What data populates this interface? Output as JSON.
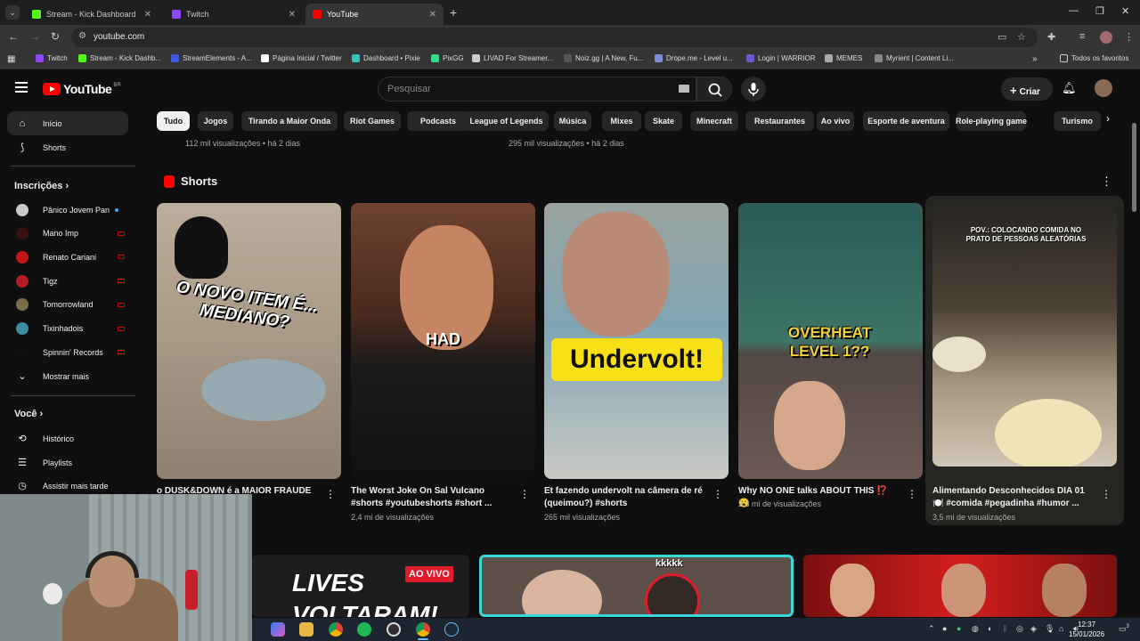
{
  "browser": {
    "tabs": [
      {
        "label": "Stream - Kick Dashboard",
        "color": "#53fc18"
      },
      {
        "label": "Twitch",
        "color": "#9146ff"
      },
      {
        "label": "YouTube",
        "color": "#ff0000"
      }
    ],
    "url": "youtube.com",
    "bookmarks": [
      {
        "label": "Twitch",
        "color": "#9146ff"
      },
      {
        "label": "Stream - Kick Dashb...",
        "color": "#53fc18"
      },
      {
        "label": "StreamElements - A...",
        "color": "#3b5bdb"
      },
      {
        "label": "Página Inicial / Twitter",
        "color": "#ffffff"
      },
      {
        "label": "Dashboard • Pixie",
        "color": "#2ec4b6"
      },
      {
        "label": "PixGG",
        "color": "#39d98a"
      },
      {
        "label": "LIVAD For Streamer...",
        "color": "#cccccc"
      },
      {
        "label": "Noiz.gg | A New, Fu...",
        "color": "#555555"
      },
      {
        "label": "Drope.me - Level u...",
        "color": "#7b8cde"
      },
      {
        "label": "Login | WARRIOR",
        "color": "#6a5acd"
      },
      {
        "label": "MEMES",
        "color": "#aaaaaa"
      },
      {
        "label": "Myrient | Content Li...",
        "color": "#888888"
      }
    ],
    "favorites": "Todos os favoritos"
  },
  "youtube": {
    "logo": "YouTube",
    "country": "BR",
    "search_placeholder": "Pesquisar",
    "create_label": "Criar",
    "chips": [
      "Tudo",
      "Jogos",
      "Tirando a Maior Onda",
      "Riot Games",
      "Podcasts",
      "League of Legends",
      "Música",
      "Mixes",
      "Skate",
      "Minecraft",
      "Restaurantes",
      "Ao vivo",
      "Esporte de aventura",
      "Role-playing game",
      "Turismo"
    ]
  },
  "sidebar": {
    "home": "Início",
    "shorts": "Shorts",
    "subscriptions_header": "Inscrições",
    "channels": [
      {
        "name": "Pânico Jovem Pan",
        "color": "#c9c9c9",
        "status": "dot"
      },
      {
        "name": "Mano Imp",
        "color": "#3a0f10",
        "status": "live"
      },
      {
        "name": "Renato Cariani",
        "color": "#c01818",
        "status": "live"
      },
      {
        "name": "Tigz",
        "color": "#b31d2a",
        "status": "live"
      },
      {
        "name": "Tomorrowland",
        "color": "#7b6c4a",
        "status": "live"
      },
      {
        "name": "Tixinhadois",
        "color": "#3e8aa0",
        "status": "live"
      },
      {
        "name": "Spinnin' Records",
        "color": "#111111",
        "status": "live"
      }
    ],
    "show_more": "Mostrar mais",
    "you_header": "Você",
    "you_items": [
      "Histórico",
      "Playlists",
      "Assistir mais tarde"
    ]
  },
  "previous_row_views": [
    "112 mil visualizações • há 2 dias",
    "295 mil visualizações • há 2 dias"
  ],
  "shorts_section": {
    "title": "Shorts",
    "items": [
      {
        "title": "o DUSK&DOWN é a MAIOR FRAUDE",
        "views": "",
        "overlay": "O NOVO ITEM É... MEDIANO?"
      },
      {
        "title": "The Worst Joke On Sal Vulcano #shorts #youtubeshorts #short ...",
        "views": "2,4 mi de visualizações",
        "overlay": "HAD"
      },
      {
        "title": "Et fazendo undervolt na câmera de ré (queimou?) #shorts",
        "views": "265 mil visualizações",
        "overlay": "Undervolt!"
      },
      {
        "title": "Why NO ONE talks ABOUT THIS ⁉️😮",
        "views": "2,3 mi de visualizações",
        "overlay": "OVERHEAT LEVEL 1??"
      },
      {
        "title": "Alimentando Desconhecidos DIA 01 🍽️ #comida #pegadinha #humor ...",
        "views": "3,5 mi de visualizações",
        "overlay": "POV.: COLOCANDO COMIDA NO PRATO DE PESSOAS ALEATÓRIAS"
      }
    ]
  },
  "bottom_row": {
    "tile1_text": "LIVES VOLTARAM!",
    "tile1_badge": "AO VIVO",
    "tile2_text": "kkkkk"
  },
  "taskbar": {
    "time": "12:37",
    "date": "15/01/2026",
    "notifications": "3"
  }
}
